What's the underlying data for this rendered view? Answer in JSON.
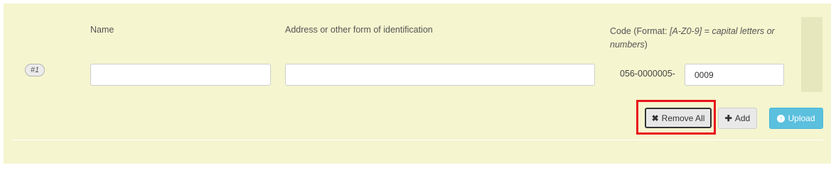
{
  "headers": {
    "name": "Name",
    "address": "Address or other form of identification",
    "code_prefix_text": "Code (Format: ",
    "code_format_italic": "[A-Z0-9] = capital letters or numbers",
    "code_suffix_text": ")"
  },
  "row": {
    "badge": "#1",
    "name_value": "",
    "address_value": "",
    "code_prefix": "056-0000005-",
    "code_value": "0009"
  },
  "buttons": {
    "remove_all": "Remove All",
    "add": "Add",
    "upload": "Upload"
  },
  "icons": {
    "remove": "times-icon",
    "add": "plus-icon",
    "upload": "arrow-up-circle-icon"
  },
  "colors": {
    "panel_bg": "#f5f5cf",
    "upload_btn": "#5bc0de",
    "highlight": "#e8141b"
  }
}
